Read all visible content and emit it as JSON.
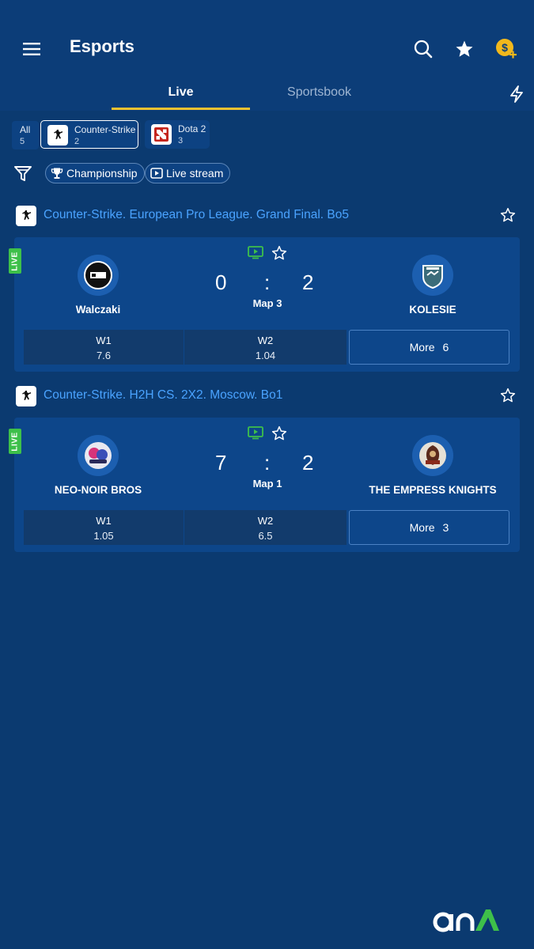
{
  "header": {
    "title": "Esports"
  },
  "tabs": [
    {
      "label": "Live"
    },
    {
      "label": "Sportsbook"
    }
  ],
  "sports": [
    {
      "name": "All",
      "count": "5"
    },
    {
      "name": "Counter-Strike",
      "count": "2"
    },
    {
      "name": "Dota 2",
      "count": "3"
    }
  ],
  "filters": {
    "championship": "Championship",
    "live_stream": "Live stream"
  },
  "events": [
    {
      "league": "Counter-Strike. European Pro League. Grand Final. Bo5",
      "live": "LIVE",
      "team1": "Walczaki",
      "team2": "KOLESIE",
      "score1": "0",
      "score2": "2",
      "separator": ":",
      "map": "Map 3",
      "w1_label": "W1",
      "w1_value": "7.6",
      "w2_label": "W2",
      "w2_value": "1.04",
      "more_label": "More",
      "more_count": "6"
    },
    {
      "league": "Counter-Strike. H2H CS. 2X2. Moscow. Bo1",
      "live": "LIVE",
      "team1": "NEO-NOIR BROS",
      "team2": "THE EMPRESS KNIGHTS",
      "score1": "7",
      "score2": "2",
      "separator": ":",
      "map": "Map 1",
      "w1_label": "W1",
      "w1_value": "1.05",
      "w2_label": "W2",
      "w2_value": "6.5",
      "more_label": "More",
      "more_count": "3"
    }
  ],
  "colors": {
    "background": "#0b3a70",
    "card": "#0d468a",
    "accent": "#f2c230",
    "link": "#4aa3ff",
    "live": "#3ec04a"
  },
  "icons": [
    "menu-icon",
    "search-icon",
    "star-icon",
    "coin-plus-icon",
    "bolt-icon",
    "filter-icon",
    "trophy-icon",
    "play-icon",
    "tv-icon"
  ]
}
